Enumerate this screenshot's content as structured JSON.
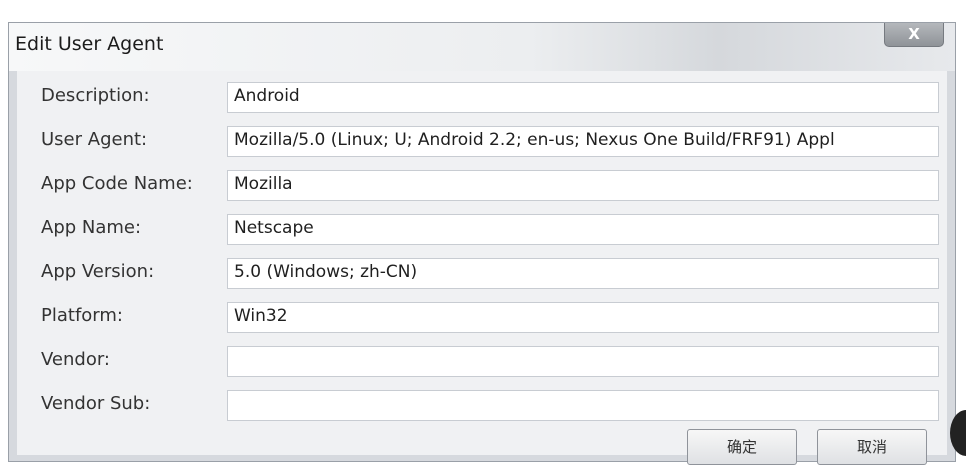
{
  "dialog": {
    "title": "Edit User Agent",
    "close_label": "X"
  },
  "fields": [
    {
      "label": "Description:",
      "value": "Android"
    },
    {
      "label": "User Agent:",
      "value": "Mozilla/5.0 (Linux; U; Android 2.2; en-us; Nexus One Build/FRF91) Appl"
    },
    {
      "label": "App Code Name:",
      "value": "Mozilla"
    },
    {
      "label": "App Name:",
      "value": "Netscape"
    },
    {
      "label": "App Version:",
      "value": "5.0 (Windows; zh-CN)"
    },
    {
      "label": "Platform:",
      "value": "Win32"
    },
    {
      "label": "Vendor:",
      "value": ""
    },
    {
      "label": "Vendor Sub:",
      "value": ""
    }
  ],
  "buttons": {
    "ok_label": "确定",
    "cancel_label": "取消"
  }
}
